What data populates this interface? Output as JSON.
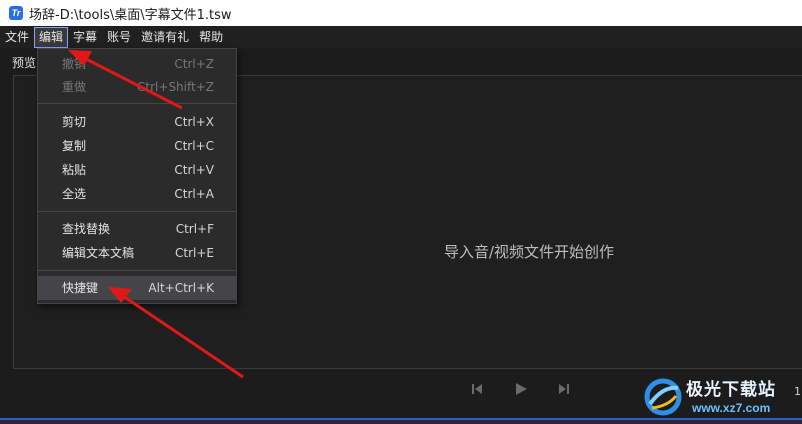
{
  "window": {
    "title": "场辞-D:\\tools\\桌面\\字幕文件1.tsw",
    "logo_text": "Tr"
  },
  "menubar": [
    {
      "label": "文件"
    },
    {
      "label": "编辑"
    },
    {
      "label": "字幕"
    },
    {
      "label": "账号"
    },
    {
      "label": "邀请有礼"
    },
    {
      "label": "帮助"
    }
  ],
  "workspace": {
    "preview_tab": "预览",
    "import_hint": "导入音/视频文件开始创作",
    "timecode_fragment": "1."
  },
  "edit_menu": {
    "items": [
      {
        "label": "撤销",
        "shortcut": "Ctrl+Z",
        "enabled": false
      },
      {
        "label": "重做",
        "shortcut": "Ctrl+Shift+Z",
        "enabled": false
      },
      {
        "label": "剪切",
        "shortcut": "Ctrl+X",
        "enabled": true
      },
      {
        "label": "复制",
        "shortcut": "Ctrl+C",
        "enabled": true
      },
      {
        "label": "粘贴",
        "shortcut": "Ctrl+V",
        "enabled": true
      },
      {
        "label": "全选",
        "shortcut": "Ctrl+A",
        "enabled": true
      },
      {
        "label": "查找替换",
        "shortcut": "Ctrl+F",
        "enabled": true
      },
      {
        "label": "编辑文本文稿",
        "shortcut": "Ctrl+E",
        "enabled": true
      },
      {
        "label": "快捷键",
        "shortcut": "Alt+Ctrl+K",
        "enabled": true,
        "highlighted": true
      }
    ]
  },
  "watermark": {
    "name": "极光下载站",
    "url": "www.xz7.com"
  },
  "colors": {
    "accent_blue": "#2e5bd8",
    "annotation_arrow": "#e01818",
    "menu_bg": "#2b2b2b"
  }
}
